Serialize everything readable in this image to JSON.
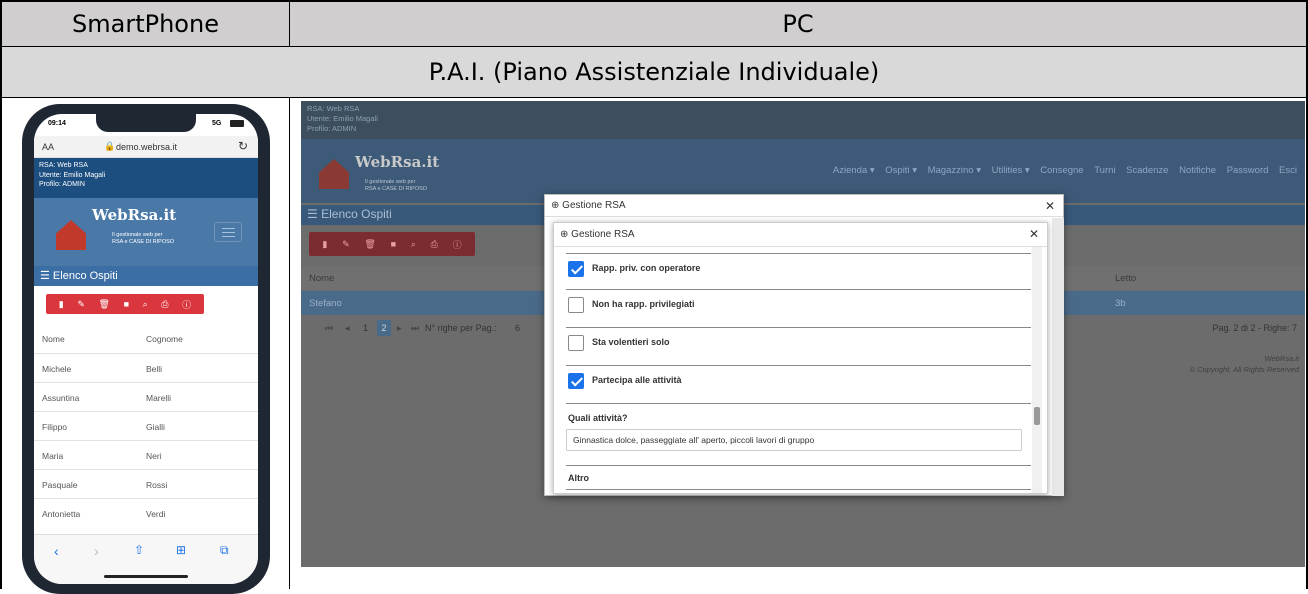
{
  "table": {
    "col_smartphone": "SmartPhone",
    "col_pc": "PC",
    "section_title": "P.A.I. (Piano Assistenziale Individuale)"
  },
  "phone": {
    "time": "09:14",
    "signal": "5G",
    "aa": "AA",
    "url": "demo.webrsa.it",
    "rsa": "RSA: Web RSA",
    "utente": "Utente: Emilio Magali",
    "profilo": "Profilo: ADMIN",
    "logo": "WebRsa.it",
    "tagline1": "Il gestionale web per",
    "tagline2": "RSA e CASE DI RIPOSO",
    "list_header": "Elenco Ospiti",
    "col_nome": "Nome",
    "col_cognome": "Cognome",
    "rows": [
      {
        "nome": "Michele",
        "cognome": "Belli"
      },
      {
        "nome": "Assuntina",
        "cognome": "Marelli"
      },
      {
        "nome": "Filippo",
        "cognome": "Gialli"
      },
      {
        "nome": "Maria",
        "cognome": "Neri"
      },
      {
        "nome": "Pasquale",
        "cognome": "Rossi"
      },
      {
        "nome": "Antonietta",
        "cognome": "Verdi"
      }
    ]
  },
  "pc": {
    "rsa": "RSA: Web RSA",
    "utente": "Utente: Emilio Magali",
    "profilo": "Profilo: ADMIN",
    "logo": "WebRsa.it",
    "tagline1": "Il gestionale web per",
    "tagline2": "RSA e CASE DI RIPOSO",
    "nav": [
      "Azienda ▾",
      "Ospiti ▾",
      "Magazzino ▾",
      "Utilities ▾",
      "Consegne",
      "Turni",
      "Scadenze",
      "Notifiche",
      "Password",
      "Esci"
    ],
    "list_header": "Elenco Ospiti",
    "col_nome": "Nome",
    "col_letto": "Letto",
    "row_nome": "Stefano",
    "row_letto": "3b",
    "pager_pages": [
      "1",
      "2"
    ],
    "pager_label": "N° righe per Pag.:",
    "pager_value": "6",
    "pager_info": "Pag. 2 di 2 - Righe: 7",
    "footer1": "WebRsa.it",
    "footer2": "© Copyright. All Rights Reserved",
    "dialog_outer_title": "Gestione RSA",
    "dialog_inner_title": "Gestione RSA",
    "options": [
      {
        "label": "Rapp. priv. con operatore",
        "checked": true
      },
      {
        "label": "Non ha rapp. privilegiati",
        "checked": false
      },
      {
        "label": "Sta volentieri solo",
        "checked": false
      },
      {
        "label": "Partecipa alle attività",
        "checked": true
      }
    ],
    "quali_label": "Quali attività?",
    "quali_value": "Ginnastica dolce, passeggiate all' aperto, piccoli lavori di gruppo",
    "altro_label": "Altro"
  },
  "colors": {
    "accent_red": "#d9363e",
    "brand_blue": "#3a6ea5",
    "check_blue": "#1a73e8"
  }
}
